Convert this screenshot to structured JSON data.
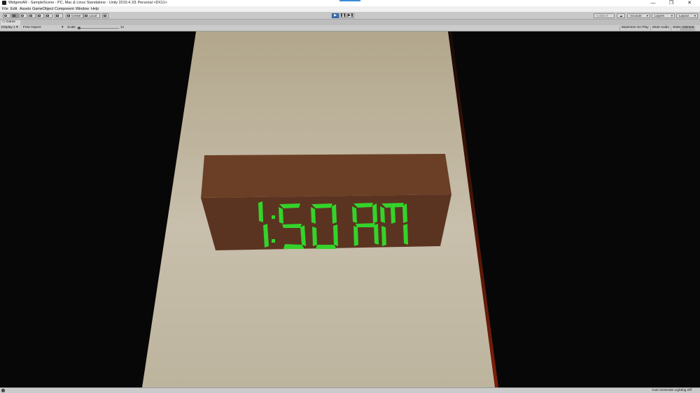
{
  "window": {
    "title": "WidgetsAR - SampleScene - PC, Mac & Linux Standalone - Unity 2019.4.1f1 Personal <DX11>",
    "controls": [
      "—",
      "❐",
      "✕"
    ]
  },
  "menu": [
    "File",
    "Edit",
    "Assets",
    "GameObject",
    "Component",
    "Window",
    "Help"
  ],
  "toolbar": {
    "pivot_label": "Center",
    "space_label": "Local",
    "play_controls": [
      "▶",
      "❚❚",
      "▶❚"
    ],
    "collab_label": "Collab ▾",
    "account_label": "Account",
    "layers_label": "Layers",
    "layout_label": "Layout"
  },
  "game_tab": {
    "label": "Game"
  },
  "game_toolbar": {
    "display": "Display 1",
    "aspect": "Free Aspect",
    "scale_label": "Scale",
    "scale_value": "1x",
    "buttons": [
      "Maximize On Play",
      "Mute Audio",
      "Stats",
      "Gizmos"
    ]
  },
  "scene": {
    "clock_time": "1:50 AM",
    "colors": {
      "background": "#070707",
      "floor": "#bfb6a0",
      "box_top": "#6a3e25",
      "box_front": "#5a3320",
      "digits": "#35d62c"
    }
  },
  "status": {
    "lighting": "Auto Generate Lighting Off"
  }
}
